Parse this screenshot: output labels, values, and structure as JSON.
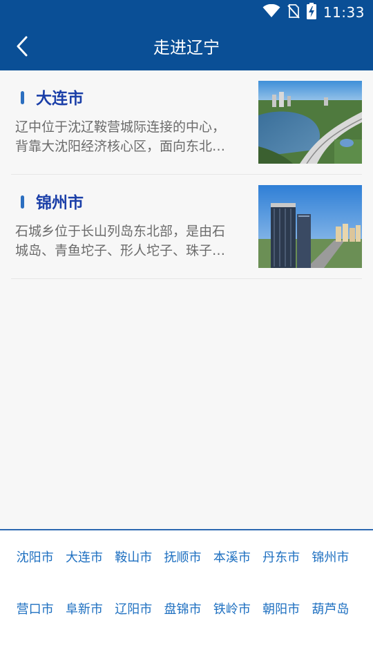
{
  "status_bar": {
    "time": "11:33",
    "icons": [
      "wifi-icon",
      "no-sim-icon",
      "battery-charging-icon"
    ]
  },
  "header": {
    "title": "走进辽宁",
    "back_icon": "chevron-left-icon",
    "background": "#0a4f96"
  },
  "cities_list": [
    {
      "title": "大连市",
      "desc_lines": [
        "辽中位于沈辽鞍营城际连接的中心，",
        "背靠大沈阳经济核心区，面向东北…"
      ],
      "image": "city-lake-aerial-photo"
    },
    {
      "title": "锦州市",
      "desc_lines": [
        "石城乡位于长山列岛东北部，是由石",
        "城岛、青鱼坨子、形人坨子、珠子…"
      ],
      "image": "city-skyscraper-photo"
    }
  ],
  "city_nav": [
    "沈阳市",
    "大连市",
    "鞍山市",
    "抚顺市",
    "本溪市",
    "丹东市",
    "锦州市",
    "营口市",
    "阜新市",
    "辽阳市",
    "盘锦市",
    "铁岭市",
    "朝阳市",
    "葫芦岛"
  ],
  "colors": {
    "accent": "#0a4f96",
    "card_title": "#1b3fa8",
    "link": "#1d6fc0"
  }
}
